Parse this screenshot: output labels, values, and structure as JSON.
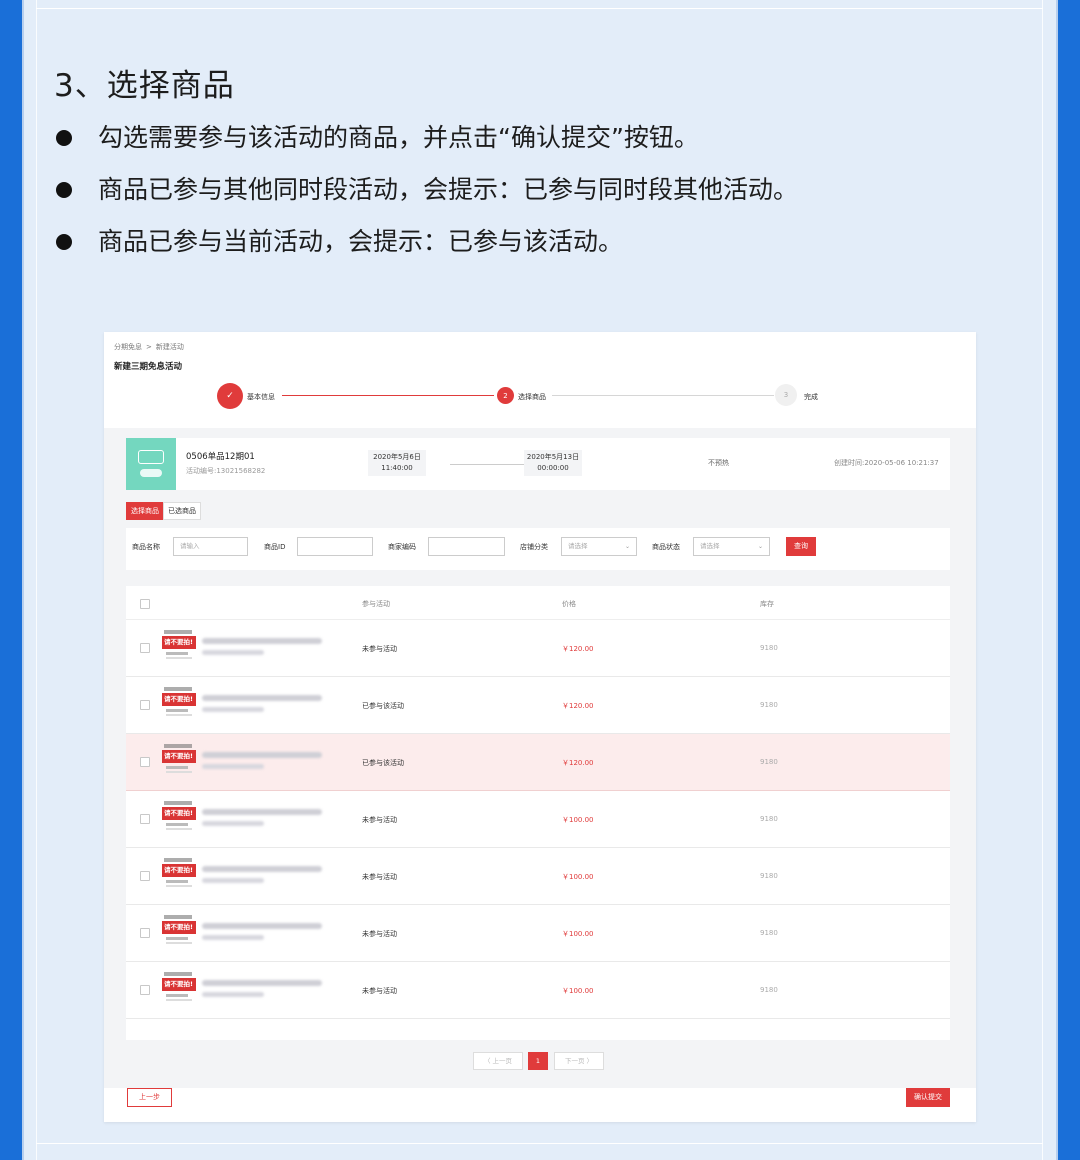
{
  "heading": "3、选择商品",
  "bullets": [
    "勾选需要参与该活动的商品，并点击“确认提交”按钮。",
    "商品已参与其他同时段活动，会提示：已参与同时段其他活动。",
    "商品已参与当前活动，会提示：已参与该活动。"
  ],
  "shot": {
    "breadcrumb": [
      "分期免息",
      "新建活动"
    ],
    "breadcrumb_sep": ">",
    "title": "新建三期免息活动",
    "steps": [
      {
        "num": "✓",
        "label": "基本信息"
      },
      {
        "num": "2",
        "label": "选择商品"
      },
      {
        "num": "3",
        "label": "完成"
      }
    ],
    "activity": {
      "name": "0506单品12期01",
      "code": "活动编号:13021568282",
      "start_date": "2020年5月6日",
      "start_time": "11:40:00",
      "end_date": "2020年5月13日",
      "end_time": "00:00:00",
      "status": "不预热",
      "created": "创建时间:2020-05-06 10:21:37"
    },
    "tabs": [
      "选择商品",
      "已选商品"
    ],
    "filters": {
      "name_label": "商品名称",
      "name_placeholder": "请输入",
      "id_label": "商品ID",
      "code_label": "商家编码",
      "shop_cat_label": "店铺分类",
      "shop_cat_value": "请选择",
      "status_label": "商品状态",
      "status_value": "请选择",
      "query_button": "查询"
    },
    "table": {
      "headers": [
        "参与活动",
        "价格",
        "库存"
      ],
      "thumb_text": "请不要拍!",
      "rows": [
        {
          "status": "未参与活动",
          "price": "￥120.00",
          "stock": "9180",
          "highlight": false
        },
        {
          "status": "已参与该活动",
          "price": "￥120.00",
          "stock": "9180",
          "highlight": false
        },
        {
          "status": "已参与该活动",
          "price": "￥120.00",
          "stock": "9180",
          "highlight": true
        },
        {
          "status": "未参与活动",
          "price": "￥100.00",
          "stock": "9180",
          "highlight": false
        },
        {
          "status": "未参与活动",
          "price": "￥100.00",
          "stock": "9180",
          "highlight": false
        },
        {
          "status": "未参与活动",
          "price": "￥100.00",
          "stock": "9180",
          "highlight": false
        },
        {
          "status": "未参与活动",
          "price": "￥100.00",
          "stock": "9180",
          "highlight": false
        }
      ]
    },
    "pagination": {
      "prev": "〈 上一页",
      "current": "1",
      "next": "下一页 〉"
    },
    "prev_step_button": "上一步",
    "submit_button": "确认提交"
  },
  "colors": {
    "accent": "#e03b3b",
    "background": "#1a6fd8",
    "panel": "#e3edf9",
    "highlight_row": "#fcecec"
  }
}
